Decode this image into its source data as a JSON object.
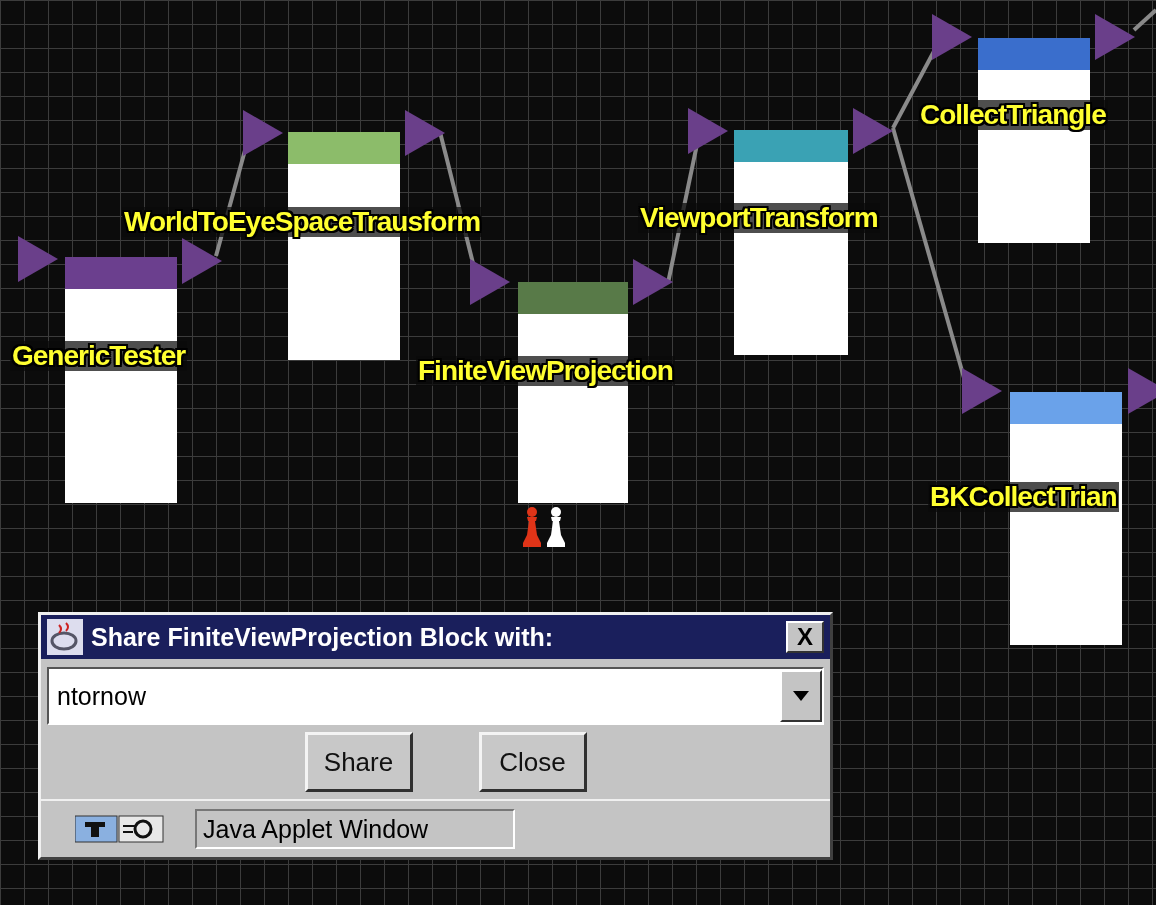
{
  "canvas": {
    "blocks": [
      {
        "label": "GenericTester",
        "color": "#6b3f8e"
      },
      {
        "label": "WorldToEyeSpaceTrausform",
        "color": "#8cbc6a"
      },
      {
        "label": "FiniteViewProjection",
        "color": "#587a48"
      },
      {
        "label": "ViewportTransform",
        "color": "#3aa2b4"
      },
      {
        "label": "CollectTriangle",
        "color": "#3a6ecc"
      },
      {
        "label": "BKCollectTrian",
        "color": "#6aa2ea"
      }
    ],
    "markers": [
      {
        "color": "#e03418"
      },
      {
        "color": "#ffffff"
      }
    ]
  },
  "dialog": {
    "title": "Share FiniteViewProjection Block with:",
    "close_glyph": "X",
    "select": {
      "value": "ntornow"
    },
    "buttons": [
      "Share",
      "Close"
    ],
    "status": "Java Applet Window"
  }
}
